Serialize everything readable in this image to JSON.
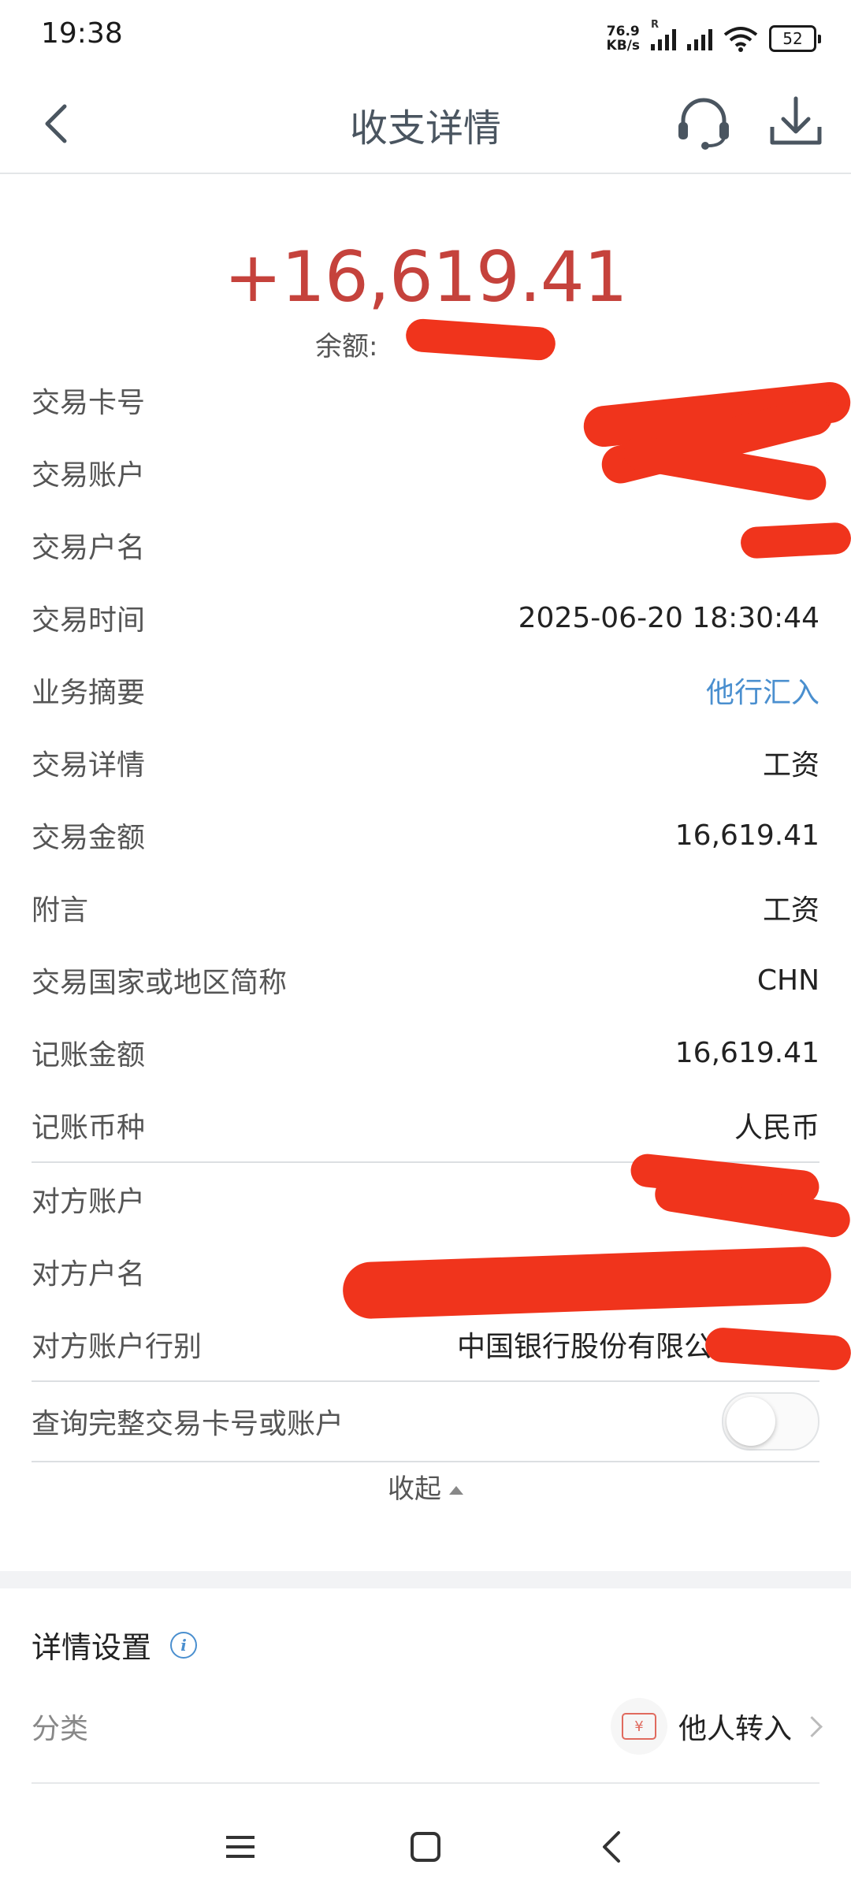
{
  "status_bar": {
    "time": "19:38",
    "net_speed_value": "76.9",
    "net_speed_unit": "KB/s",
    "roaming_label": "R",
    "battery": "52",
    "icons": [
      "signal-icon",
      "signal-icon",
      "wifi-icon",
      "battery-icon"
    ]
  },
  "header": {
    "title": "收支详情",
    "back_icon": "back-icon",
    "service_icon": "headset-icon",
    "download_icon": "download-icon"
  },
  "summary": {
    "amount": "+16,619.41",
    "balance_label": "余额:"
  },
  "details": {
    "rows": [
      {
        "label": "交易卡号",
        "value": ""
      },
      {
        "label": "交易账户",
        "value": ""
      },
      {
        "label": "交易户名",
        "value": ""
      },
      {
        "label": "交易时间",
        "value": "2025-06-20 18:30:44"
      },
      {
        "label": "业务摘要",
        "value": "他行汇入"
      },
      {
        "label": "交易详情",
        "value": "工资"
      },
      {
        "label": "交易金额",
        "value": "16,619.41"
      },
      {
        "label": "附言",
        "value": "工资"
      },
      {
        "label": "交易国家或地区简称",
        "value": "CHN"
      },
      {
        "label": "记账金额",
        "value": "16,619.41"
      },
      {
        "label": "记账币种",
        "value": "人民币"
      }
    ],
    "counterparty": [
      {
        "label": "对方账户",
        "value": ""
      },
      {
        "label": "对方户名",
        "value": ""
      },
      {
        "label": "对方账户行别",
        "value": "中国银行股份有限公司"
      }
    ],
    "full_number_toggle_label": "查询完整交易卡号或账户",
    "full_number_toggle_on": false
  },
  "collapse_label": "收起",
  "settings": {
    "title": "详情设置",
    "category_label": "分类",
    "category_icon_glyph": "¥",
    "category_value": "他人转入"
  },
  "colors": {
    "amount": "#c5423c",
    "link": "#4a8fcf",
    "redaction": "#f0341c"
  }
}
